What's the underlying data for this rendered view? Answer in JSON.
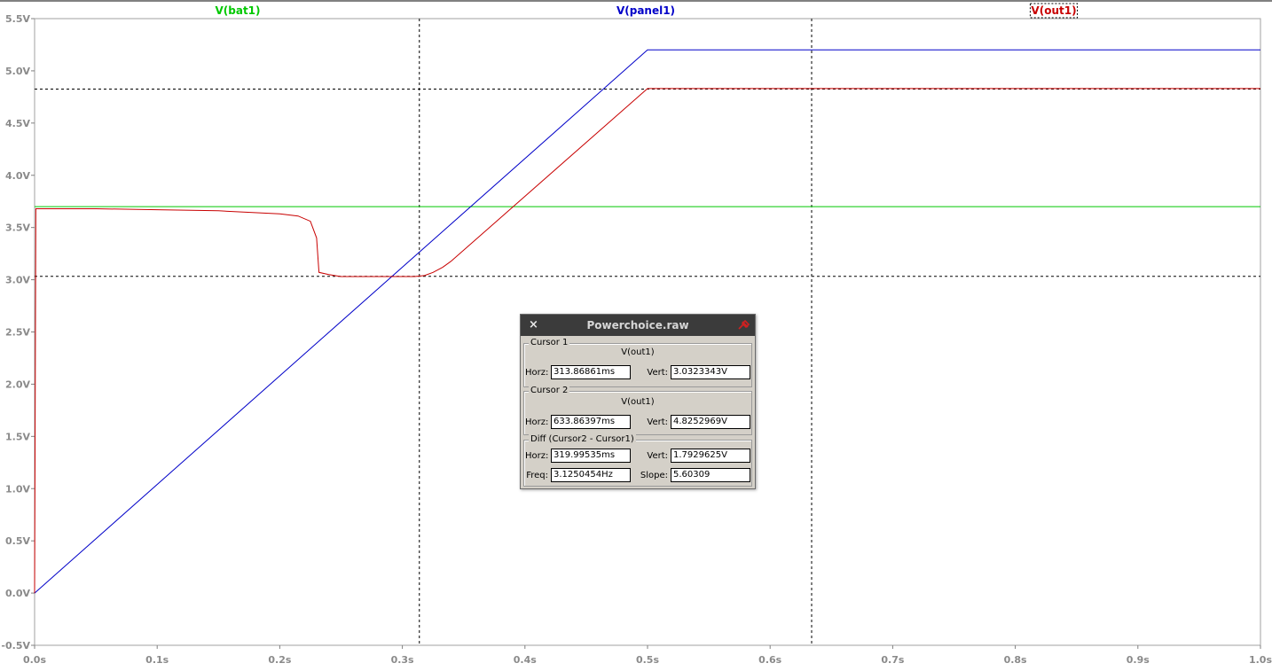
{
  "chart_data": {
    "type": "line",
    "xlim": [
      0,
      1.0
    ],
    "ylim": [
      -0.5,
      5.5
    ],
    "xticks": [
      "0.0s",
      "0.1s",
      "0.2s",
      "0.3s",
      "0.4s",
      "0.5s",
      "0.6s",
      "0.7s",
      "0.8s",
      "0.9s",
      "1.0s"
    ],
    "yticks": [
      "-0.5V",
      "0.0V",
      "0.5V",
      "1.0V",
      "1.5V",
      "2.0V",
      "2.5V",
      "3.0V",
      "3.5V",
      "4.0V",
      "4.5V",
      "5.0V",
      "5.5V"
    ],
    "grid": false,
    "series": [
      {
        "name": "V(bat1)",
        "color": "#00c800",
        "x": [
          0,
          1.0
        ],
        "y": [
          3.7,
          3.7
        ]
      },
      {
        "name": "V(panel1)",
        "color": "#0000c8",
        "x": [
          0,
          0.5,
          1.0
        ],
        "y": [
          0.0,
          5.2,
          5.2
        ]
      },
      {
        "name": "V(out1)",
        "color": "#c80000",
        "x": [
          0,
          0.001,
          0.05,
          0.1,
          0.15,
          0.2,
          0.215,
          0.225,
          0.23,
          0.232,
          0.24,
          0.25,
          0.3,
          0.31,
          0.318,
          0.325,
          0.333,
          0.34,
          0.5,
          1.0
        ],
        "y": [
          0.0,
          3.68,
          3.68,
          3.67,
          3.66,
          3.63,
          3.61,
          3.56,
          3.4,
          3.07,
          3.05,
          3.03,
          3.03,
          3.03,
          3.04,
          3.07,
          3.12,
          3.18,
          4.83,
          4.83
        ]
      }
    ],
    "cursors": {
      "x": [
        0.31386861,
        0.63386397
      ],
      "y": [
        3.0323343,
        4.8252969
      ]
    }
  },
  "cursor_window": {
    "title": "Powerchoice.raw",
    "close_glyph": "×",
    "cursor1": {
      "legend": "Cursor 1",
      "trace": "V(out1)",
      "horz_label": "Horz:",
      "horz_value": "313.86861ms",
      "vert_label": "Vert:",
      "vert_value": "3.0323343V"
    },
    "cursor2": {
      "legend": "Cursor 2",
      "trace": "V(out1)",
      "horz_label": "Horz:",
      "horz_value": "633.86397ms",
      "vert_label": "Vert:",
      "vert_value": "4.8252969V"
    },
    "diff": {
      "legend": "Diff (Cursor2 - Cursor1)",
      "horz_label": "Horz:",
      "horz_value": "319.99535ms",
      "vert_label": "Vert:",
      "vert_value": "1.7929625V",
      "freq_label": "Freq:",
      "freq_value": "3.1250454Hz",
      "slope_label": "Slope:",
      "slope_value": "5.60309"
    }
  },
  "icons": {
    "close": "close-icon",
    "pin": "pin-icon"
  }
}
